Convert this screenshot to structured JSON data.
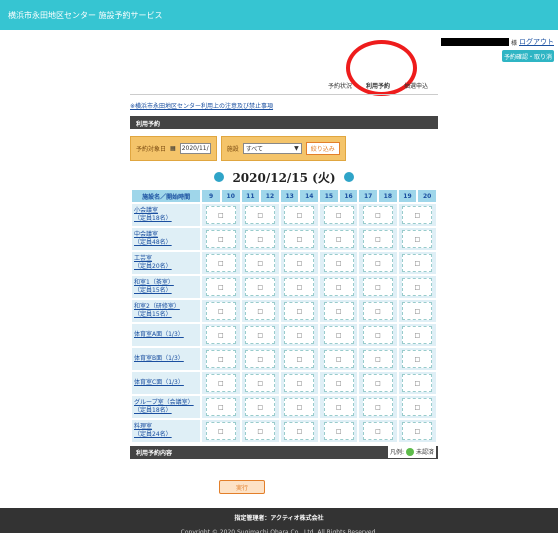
{
  "header": {
    "title": "横浜市永田地区センター 施設予約サービス"
  },
  "user": {
    "suffix": "様",
    "logout": "ログアウト",
    "confirm_button": "予約確認・取り消"
  },
  "tabs": [
    "予約状況",
    "利用予約",
    "抽選申込"
  ],
  "notice_link": "※横浜市永田地区センター利用上の注意及び禁止事項",
  "section_title": "利用予約",
  "filters": {
    "date_label": "予約対象日",
    "date_value": "2020/11/",
    "facility_label": "施設",
    "facility_value": "すべて",
    "narrow_button": "絞り込み"
  },
  "current_date": "2020/12/15 (火)",
  "table": {
    "header_label": "施設名／開始時間",
    "hours": [
      "9",
      "10",
      "11",
      "12",
      "13",
      "14",
      "15",
      "16",
      "17",
      "18",
      "19",
      "20"
    ],
    "rooms": [
      {
        "name": "小会議室",
        "cap": "（定員18名）"
      },
      {
        "name": "中会議室",
        "cap": "（定員48名）"
      },
      {
        "name": "工芸室",
        "cap": "（定員20名）"
      },
      {
        "name": "和室1（茶室）",
        "cap": "（定員15名）"
      },
      {
        "name": "和室2（研修室）",
        "cap": "（定員15名）"
      },
      {
        "name": "体育室A面（1/3）",
        "cap": ""
      },
      {
        "name": "体育室B面（1/3）",
        "cap": ""
      },
      {
        "name": "体育室C面（1/3）",
        "cap": ""
      },
      {
        "name": "グループ室（会議室）",
        "cap": "（定員18名）"
      },
      {
        "name": "料理室",
        "cap": "（定員24名）"
      }
    ],
    "slot_symbol": "□"
  },
  "contents_title": "利用予約内容",
  "legend": {
    "prefix": "凡例:",
    "label": "未認済"
  },
  "execute_button": "実行",
  "footer": {
    "manager": "指定管理者：アクティオ株式会社",
    "copyright": "Copyright © 2020 Sugimachi Ohara Co., Ltd. All Rights Reserved."
  }
}
